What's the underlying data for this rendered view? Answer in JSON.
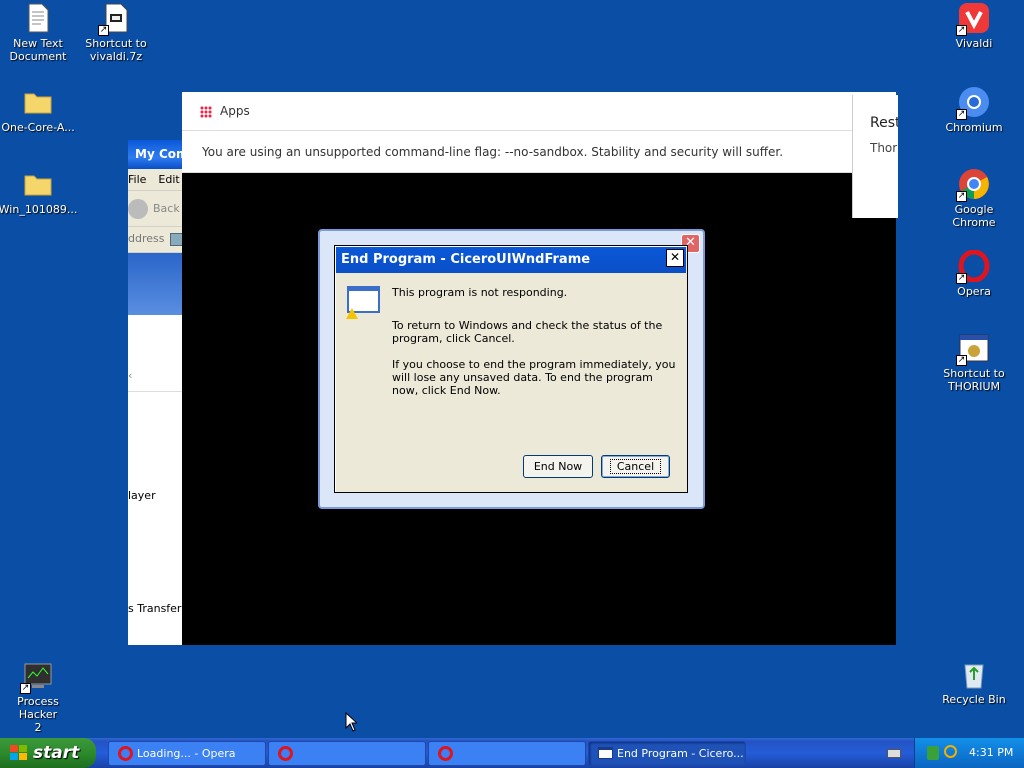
{
  "desktop": {
    "icons_left": [
      {
        "label": "New Text\nDocument"
      },
      {
        "label": "Shortcut to\nvivaldi.7z"
      },
      {
        "label": "One-Core-A..."
      },
      {
        "label": "Win_101089..."
      },
      {
        "label": "Process Hacker\n2"
      }
    ],
    "icons_right": [
      {
        "label": "Vivaldi"
      },
      {
        "label": "Chromium"
      },
      {
        "label": "Google Chrome"
      },
      {
        "label": "Opera"
      },
      {
        "label": "Shortcut to\nTHORIUM"
      },
      {
        "label": "Recycle Bin"
      }
    ]
  },
  "my_computer_window": {
    "title": "My Com",
    "menu": [
      "File",
      "Edit"
    ],
    "back_label": "Back",
    "address_label": "ddress",
    "pane_items": [
      "layer",
      "s Transfer"
    ]
  },
  "browser_window": {
    "bookmarks_apps": "Apps",
    "infobar_message": "You are using an unsupported command-line flag: --no-sandbox. Stability and security will suffer.",
    "restore_popup": {
      "title": "Rest",
      "subtitle": "Thori"
    }
  },
  "dialog": {
    "title": "End Program - CiceroUIWndFrame",
    "close_glyph": "✕",
    "message_1": "This program is not responding.",
    "message_2": "To return to Windows and check the status of the program, click Cancel.",
    "message_3": "If you choose to end the program immediately, you will lose any unsaved data. To end the program now, click End Now.",
    "end_now_label": "End Now",
    "cancel_label": "Cancel"
  },
  "taskbar": {
    "start_label": "start",
    "buttons": [
      {
        "label": "Loading... - Opera",
        "icon": "opera-icon"
      },
      {
        "label": "",
        "icon": "opera-icon"
      },
      {
        "label": "",
        "icon": "opera-icon"
      },
      {
        "label": "End Program - Cicero...",
        "icon": "window-icon"
      }
    ],
    "clock": "4:31 PM"
  },
  "colors": {
    "desktop": "#0a4ea6",
    "titlebar": "#0a58d8",
    "taskbar": "#245dd8",
    "start": "#2d8b2d",
    "dialog_face": "#ece9d8"
  }
}
